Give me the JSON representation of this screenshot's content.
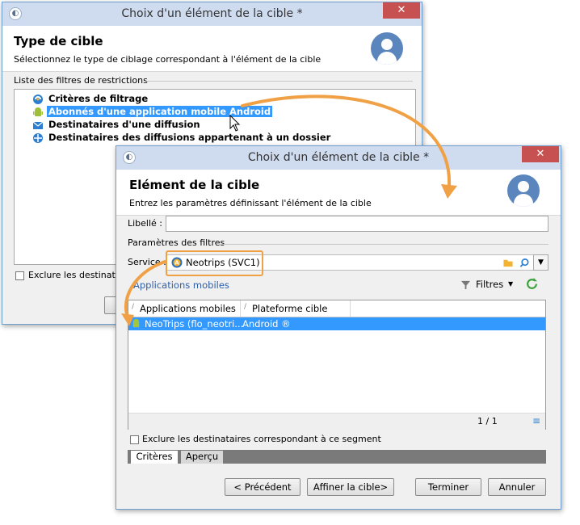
{
  "back_window": {
    "title": "Choix d'un élément de la cible *",
    "header_title": "Type de cible",
    "header_subtitle": "Sélectionnez le type de ciblage correspondant à l'élément de la cible",
    "list_label": "Liste des filtres de restrictions",
    "items": [
      {
        "label": "Critères de filtrage",
        "icon": "filter-icon"
      },
      {
        "label": "Abonnés d'une application mobile Android",
        "icon": "android-icon"
      },
      {
        "label": "Destinataires d'une diffusion",
        "icon": "envelope-icon"
      },
      {
        "label": "Destinataires des diffusions appartenant à un dossier",
        "icon": "folder-delivery-icon"
      }
    ],
    "exclude_label": "Exclure les destinataires correspondant à ce segment"
  },
  "front_window": {
    "title": "Choix d'un élément de la cible *",
    "header_title": "Elément de la cible",
    "header_subtitle": "Entrez les paramètres définissant l'élément de la cible",
    "libelle_label": "Libellé :",
    "libelle_value": "",
    "params_label": "Paramètres des filtres",
    "service_label": "Service :",
    "service_value": "Neotrips (SVC1)",
    "apps_link": "Applications mobiles",
    "filters_label": "Filtres",
    "columns": [
      "Applications mobiles",
      "Plateforme cible"
    ],
    "rows": [
      {
        "app": "NeoTrips (flo_neotri...",
        "platform": "Android ®"
      }
    ],
    "pagination": "1 / 1",
    "exclude_label": "Exclure les destinataires correspondant à ce segment",
    "tabs": [
      "Critères",
      "Aperçu"
    ],
    "buttons": {
      "previous": "< Précédent",
      "next": "Affiner la cible>",
      "finish": "Terminer",
      "cancel": "Annuler"
    }
  },
  "colors": {
    "annotation": "#f0a045",
    "selection": "#3399ff",
    "close_button": "#c75050",
    "link": "#2f5fa7"
  }
}
